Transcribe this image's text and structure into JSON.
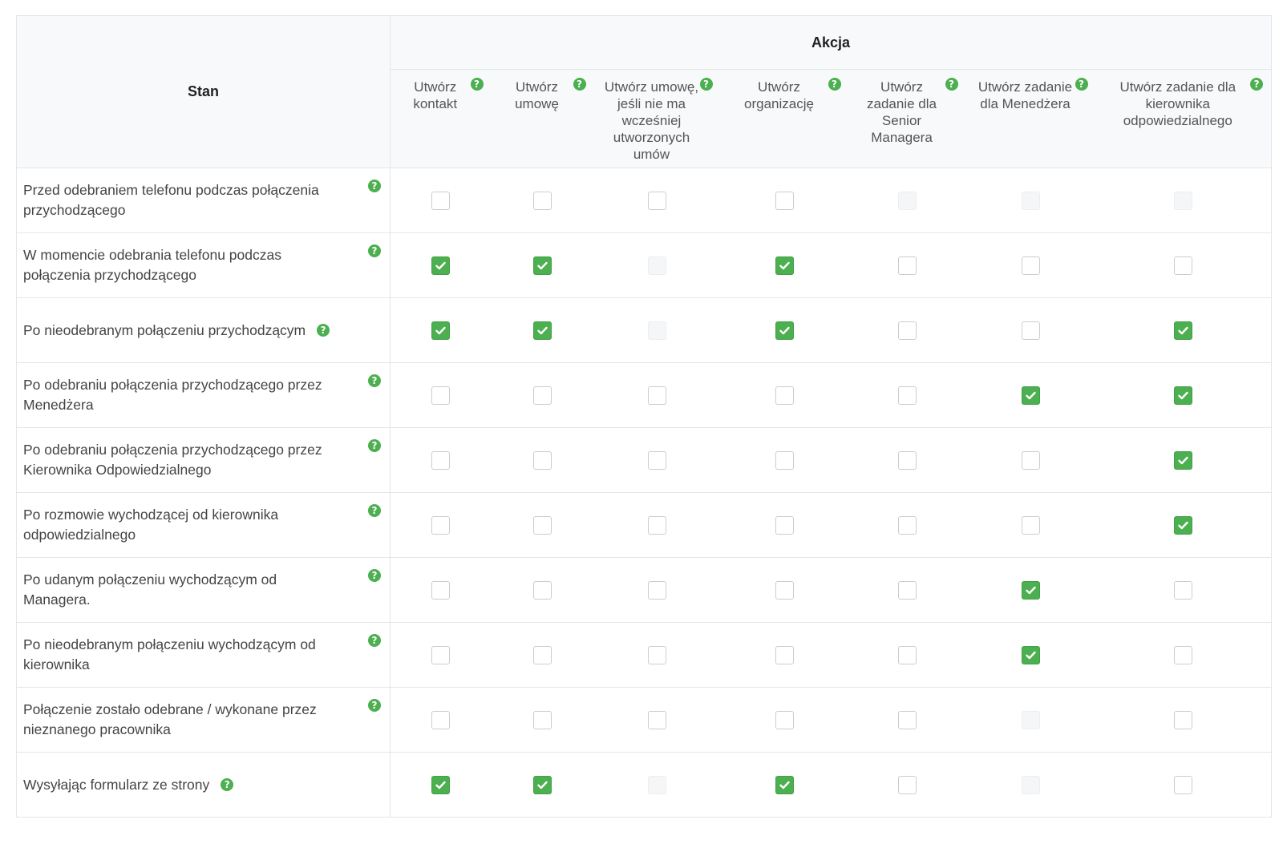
{
  "header": {
    "state_label": "Stan",
    "action_group_label": "Akcja"
  },
  "actions": [
    {
      "label": "Utwórz kontakt"
    },
    {
      "label": "Utwórz umowę"
    },
    {
      "label": "Utwórz umowę, jeśli nie ma wcześniej utworzonych umów"
    },
    {
      "label": "Utwórz organizację"
    },
    {
      "label": "Utwórz zadanie dla Senior Managera"
    },
    {
      "label": "Utwórz zadanie dla Menedżera"
    },
    {
      "label": "Utwórz zadanie dla kierownika odpowiedzialnego"
    }
  ],
  "rows": [
    {
      "state": "Przed odebraniem telefonu podczas połączenia przychodzącego",
      "cells": [
        "unchecked",
        "unchecked",
        "unchecked",
        "unchecked",
        "disabled",
        "disabled",
        "disabled"
      ]
    },
    {
      "state": "W momencie odebrania telefonu podczas połączenia przychodzącego",
      "cells": [
        "checked",
        "checked",
        "disabled",
        "checked",
        "unchecked",
        "unchecked",
        "unchecked"
      ]
    },
    {
      "state": "Po nieodebranym połączeniu przychodzącym",
      "cells": [
        "checked",
        "checked",
        "disabled",
        "checked",
        "unchecked",
        "unchecked",
        "checked"
      ]
    },
    {
      "state": "Po odebraniu połączenia przychodzącego przez Menedżera",
      "cells": [
        "unchecked",
        "unchecked",
        "unchecked",
        "unchecked",
        "unchecked",
        "checked",
        "checked"
      ]
    },
    {
      "state": "Po odebraniu połączenia przychodzącego przez Kierownika Odpowiedzialnego",
      "cells": [
        "unchecked",
        "unchecked",
        "unchecked",
        "unchecked",
        "unchecked",
        "unchecked",
        "checked"
      ]
    },
    {
      "state": "Po rozmowie wychodzącej od kierownika odpowiedzialnego",
      "cells": [
        "unchecked",
        "unchecked",
        "unchecked",
        "unchecked",
        "unchecked",
        "unchecked",
        "checked"
      ]
    },
    {
      "state": "Po udanym połączeniu wychodzącym od Managera.",
      "cells": [
        "unchecked",
        "unchecked",
        "unchecked",
        "unchecked",
        "unchecked",
        "checked",
        "unchecked"
      ]
    },
    {
      "state": "Po nieodebranym połączeniu wychodzącym od kierownika",
      "cells": [
        "unchecked",
        "unchecked",
        "unchecked",
        "unchecked",
        "unchecked",
        "checked",
        "unchecked"
      ]
    },
    {
      "state": "Połączenie zostało odebrane / wykonane przez nieznanego pracownika",
      "cells": [
        "unchecked",
        "unchecked",
        "unchecked",
        "unchecked",
        "unchecked",
        "disabled",
        "unchecked"
      ]
    },
    {
      "state": "Wysyłając formularz ze strony",
      "cells": [
        "checked",
        "checked",
        "disabled",
        "checked",
        "unchecked",
        "disabled",
        "unchecked"
      ]
    }
  ],
  "icons": {
    "help": "help-icon",
    "check": "check-icon"
  },
  "colors": {
    "accent": "#4caf50",
    "border": "#e3e6ea",
    "header_bg": "#f8f9fa"
  }
}
